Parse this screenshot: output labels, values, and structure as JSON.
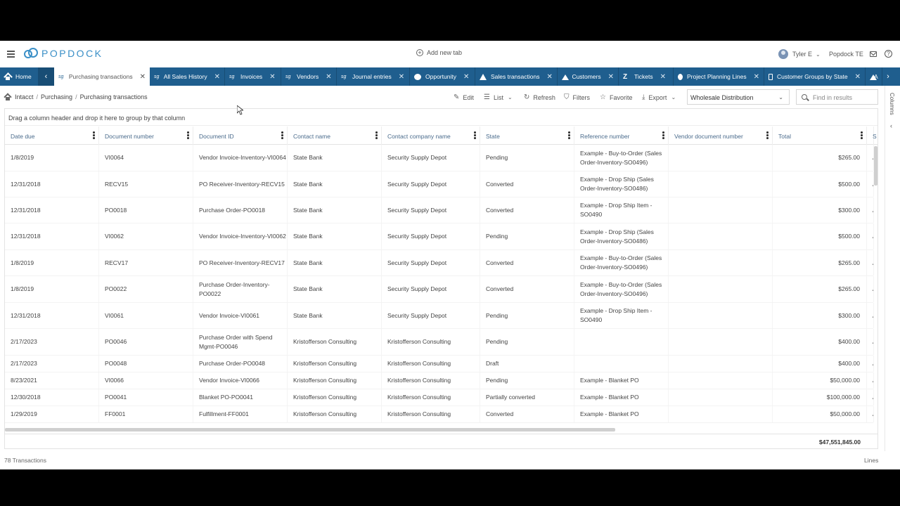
{
  "header": {
    "logo_text": "POPDOCK",
    "add_tab_label": "Add new tab",
    "user_name": "Tyler E",
    "company_name": "Popdock TE"
  },
  "tabs": [
    {
      "label": "Home",
      "icon": "home-icon"
    },
    {
      "label": "Purchasing transactions",
      "icon": "sage-icon",
      "active": true
    },
    {
      "label": "All Sales History",
      "icon": "sage-icon"
    },
    {
      "label": "Invoices",
      "icon": "sage-icon"
    },
    {
      "label": "Vendors",
      "icon": "sage-icon"
    },
    {
      "label": "Journal entries",
      "icon": "sage-icon"
    },
    {
      "label": "Opportunity",
      "icon": "cloud-icon"
    },
    {
      "label": "Sales transactions",
      "icon": "triangle-icon"
    },
    {
      "label": "Customers",
      "icon": "mountain-icon"
    },
    {
      "label": "Tickets",
      "icon": "zendesk-icon"
    },
    {
      "label": "Project Planning Lines",
      "icon": "globe-icon"
    },
    {
      "label": "Customer Groups by State",
      "icon": "box-icon"
    },
    {
      "label": "A",
      "icon": "mountain-icon"
    }
  ],
  "breadcrumb": [
    "Intacct",
    "Purchasing",
    "Purchasing transactions"
  ],
  "toolbar": {
    "edit": "Edit",
    "list": "List",
    "refresh": "Refresh",
    "filters": "Filters",
    "favorite": "Favorite",
    "export": "Export",
    "view_select": "Wholesale Distribution",
    "search_placeholder": "Find in results",
    "columns_label": "Columns"
  },
  "grid": {
    "group_hint": "Drag a column header and drop it here to group by that column",
    "columns": [
      "Date due",
      "Document number",
      "Document ID",
      "Contact name",
      "Contact company name",
      "State",
      "Reference number",
      "Vendor document number",
      "Total",
      "S"
    ],
    "rows": [
      [
        "1/8/2019",
        "VI0064",
        "Vendor Invoice-Inventory-VI0064",
        "State Bank",
        "Security Supply Depot",
        "Pending",
        "Example - Buy-to-Order (Sales Order-Inventory-SO0496)",
        "",
        "$265.00",
        "A"
      ],
      [
        "12/31/2018",
        "RECV15",
        "PO Receiver-Inventory-RECV15",
        "State Bank",
        "Security Supply Depot",
        "Converted",
        "Example - Drop Ship (Sales Order-Inventory-SO0486)",
        "",
        "$500.00",
        "A"
      ],
      [
        "12/31/2018",
        "PO0018",
        "Purchase Order-PO0018",
        "State Bank",
        "Security Supply Depot",
        "Converted",
        "Example - Drop Ship Item - SO0490",
        "",
        "$300.00",
        "A"
      ],
      [
        "12/31/2018",
        "VI0062",
        "Vendor Invoice-Inventory-VI0062",
        "State Bank",
        "Security Supply Depot",
        "Pending",
        "Example - Drop Ship (Sales Order-Inventory-SO0486)",
        "",
        "$500.00",
        "A"
      ],
      [
        "1/8/2019",
        "RECV17",
        "PO Receiver-Inventory-RECV17",
        "State Bank",
        "Security Supply Depot",
        "Converted",
        "Example - Buy-to-Order (Sales Order-Inventory-SO0496)",
        "",
        "$265.00",
        "A"
      ],
      [
        "1/8/2019",
        "PO0022",
        "Purchase Order-Inventory-PO0022",
        "State Bank",
        "Security Supply Depot",
        "Converted",
        "Example - Buy-to-Order (Sales Order-Inventory-SO0496)",
        "",
        "$265.00",
        "A"
      ],
      [
        "12/31/2018",
        "VI0061",
        "Vendor Invoice-VI0061",
        "State Bank",
        "Security Supply Depot",
        "Pending",
        "Example - Drop Ship Item - SO0490",
        "",
        "$300.00",
        "A"
      ],
      [
        "2/17/2023",
        "PO0046",
        "Purchase Order with Spend Mgmt-PO0046",
        "Kristofferson Consulting",
        "Kristofferson Consulting",
        "Pending",
        "",
        "",
        "$400.00",
        "A"
      ],
      [
        "2/17/2023",
        "PO0048",
        "Purchase Order-PO0048",
        "Kristofferson Consulting",
        "Kristofferson Consulting",
        "Draft",
        "",
        "",
        "$400.00",
        "A"
      ],
      [
        "8/23/2021",
        "VI0066",
        "Vendor Invoice-VI0066",
        "Kristofferson Consulting",
        "Kristofferson Consulting",
        "Pending",
        "Example - Blanket PO",
        "",
        "$50,000.00",
        "A"
      ],
      [
        "12/30/2018",
        "PO0041",
        "Blanket PO-PO0041",
        "Kristofferson Consulting",
        "Kristofferson Consulting",
        "Partially converted",
        "Example - Blanket PO",
        "",
        "$100,000.00",
        "A"
      ],
      [
        "1/29/2019",
        "FF0001",
        "Fulfillment-FF0001",
        "Kristofferson Consulting",
        "Kristofferson Consulting",
        "Converted",
        "Example - Blanket PO",
        "",
        "$50,000.00",
        "A"
      ]
    ],
    "grand_total": "$47,551,845.00"
  },
  "status": {
    "count": "78 Transactions",
    "lines_link": "Lines"
  },
  "colors": {
    "tab_bar": "#1f5e8e",
    "brand": "#3a8fc7",
    "header_text": "#4a6b8c"
  }
}
